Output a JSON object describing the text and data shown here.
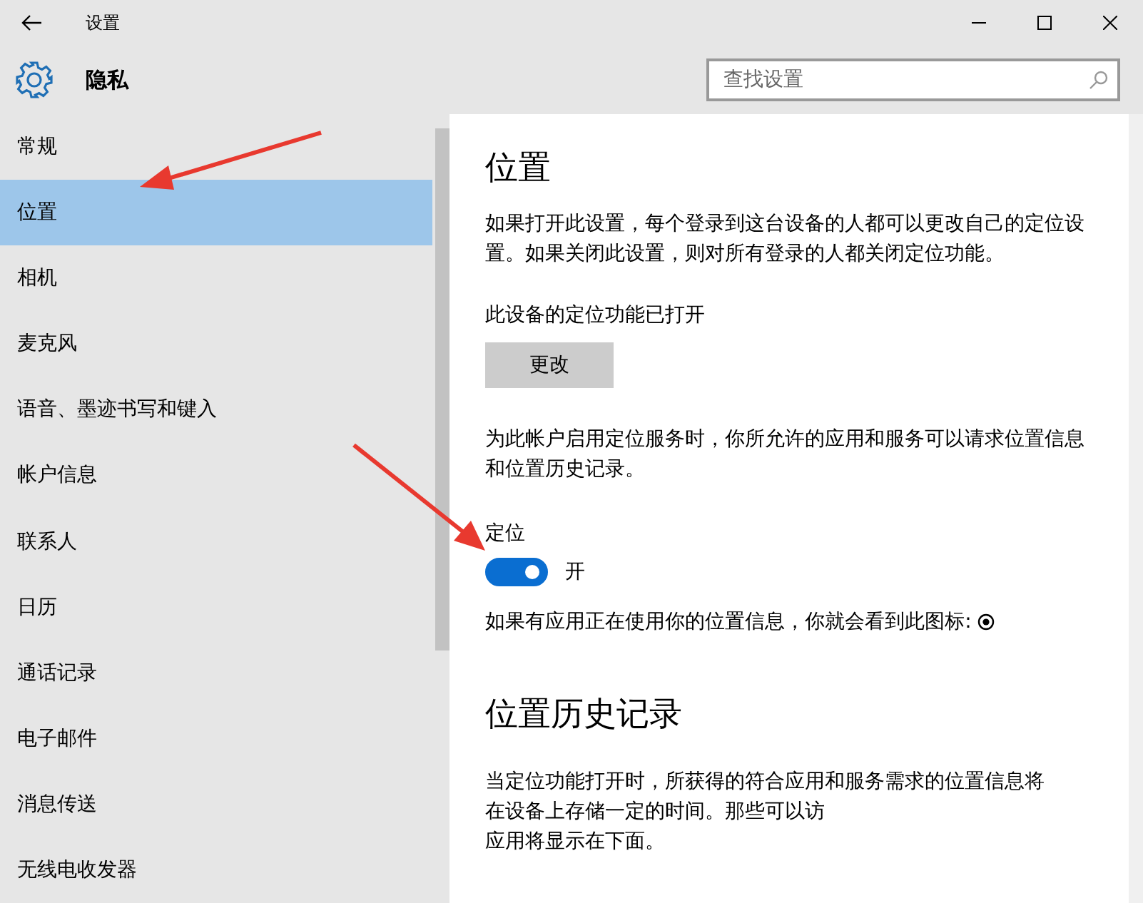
{
  "window": {
    "title": "设置"
  },
  "header": {
    "title": "隐私",
    "search": {
      "placeholder": "查找设置"
    }
  },
  "sidebar": {
    "items": [
      {
        "label": "常规",
        "selected": false
      },
      {
        "label": "位置",
        "selected": true
      },
      {
        "label": "相机",
        "selected": false
      },
      {
        "label": "麦克风",
        "selected": false
      },
      {
        "label": "语音、墨迹书写和键入",
        "selected": false
      },
      {
        "label": "帐户信息",
        "selected": false
      },
      {
        "label": "联系人",
        "selected": false
      },
      {
        "label": "日历",
        "selected": false
      },
      {
        "label": "通话记录",
        "selected": false
      },
      {
        "label": "电子邮件",
        "selected": false
      },
      {
        "label": "消息传送",
        "selected": false
      },
      {
        "label": "无线电收发器",
        "selected": false
      }
    ]
  },
  "content": {
    "title": "位置",
    "description": "如果打开此设置，每个登录到这台设备的人都可以更改自己的定位设置。如果关闭此设置，则对所有登录的人都关闭定位功能。",
    "device_status": "此设备的定位功能已打开",
    "change_button": "更改",
    "account_note": "为此帐户启用定位服务时，你所允许的应用和服务可以请求位置信息和位置历史记录。",
    "toggle": {
      "label": "定位",
      "on": true,
      "state_text": "开"
    },
    "icon_note": "如果有应用正在使用你的位置信息，你就会看到此图标:",
    "history_title": "位置历史记录",
    "history_lines": [
      "当定位功能打开时，所获得的符合应用和服务需求的位置信息将",
      "在设备上存储一定的时间。那些可以访",
      "应用将显示在下面。"
    ]
  }
}
